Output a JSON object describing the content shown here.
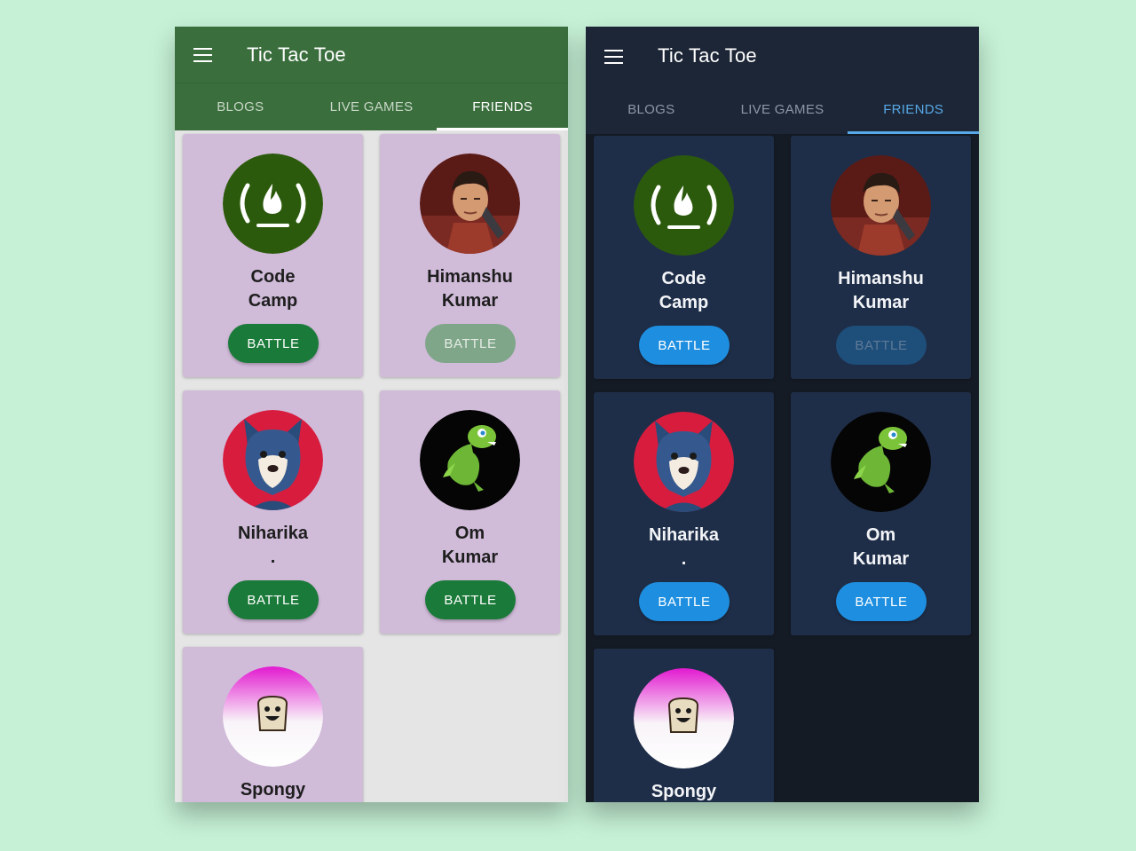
{
  "app": {
    "title": "Tic Tac Toe"
  },
  "tabs": [
    "BLOGS",
    "LIVE GAMES",
    "FRIENDS"
  ],
  "active_tab": "FRIENDS",
  "battle_label": "BATTLE",
  "friends": [
    {
      "first": "Code",
      "second": "Camp",
      "avatar": "freecodecamp-flame-logo",
      "battle_enabled": true
    },
    {
      "first": "Himanshu",
      "second": "Kumar",
      "avatar": "superhero-portrait",
      "battle_enabled": false
    },
    {
      "first": "Niharika",
      "second": ".",
      "avatar": "wolf-cartoon",
      "battle_enabled": true
    },
    {
      "first": "Om",
      "second": "Kumar",
      "avatar": "green-dinosaur-cartoon",
      "battle_enabled": true
    },
    {
      "first": "Spongy",
      "second": "",
      "avatar": "toast-cartoon",
      "battle_enabled": true
    }
  ],
  "themes": {
    "light": {
      "appbar": "#3a6e3d",
      "card": "#d0bbd9",
      "button": "#1a7a39",
      "background": "#e5e5e5"
    },
    "dark": {
      "appbar": "#1d2636",
      "card": "#1f2e48",
      "button": "#1e8fe0",
      "background": "#151b25",
      "accent": "#57a9e8"
    }
  }
}
